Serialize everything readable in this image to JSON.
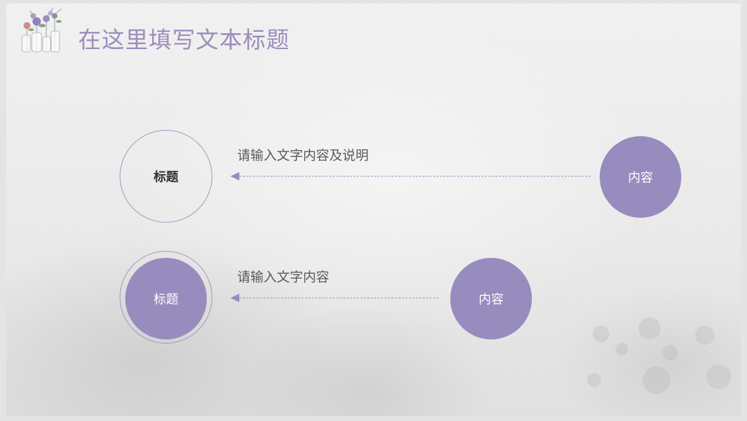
{
  "title": "在这里填写文本标题",
  "rows": [
    {
      "left_label": "标题",
      "description": "请输入文字内容及说明",
      "right_label": "内容"
    },
    {
      "left_label": "标题",
      "description": "请输入文字内容",
      "right_label": "内容"
    }
  ],
  "colors": {
    "accent": "#978cbd",
    "title": "#9c8dbd",
    "outline": "#a394c4",
    "text": "#595959",
    "label_dark": "#333333"
  },
  "icons": {
    "corner_decoration": "flower-vases-icon",
    "arrow": "arrow-left-icon"
  }
}
